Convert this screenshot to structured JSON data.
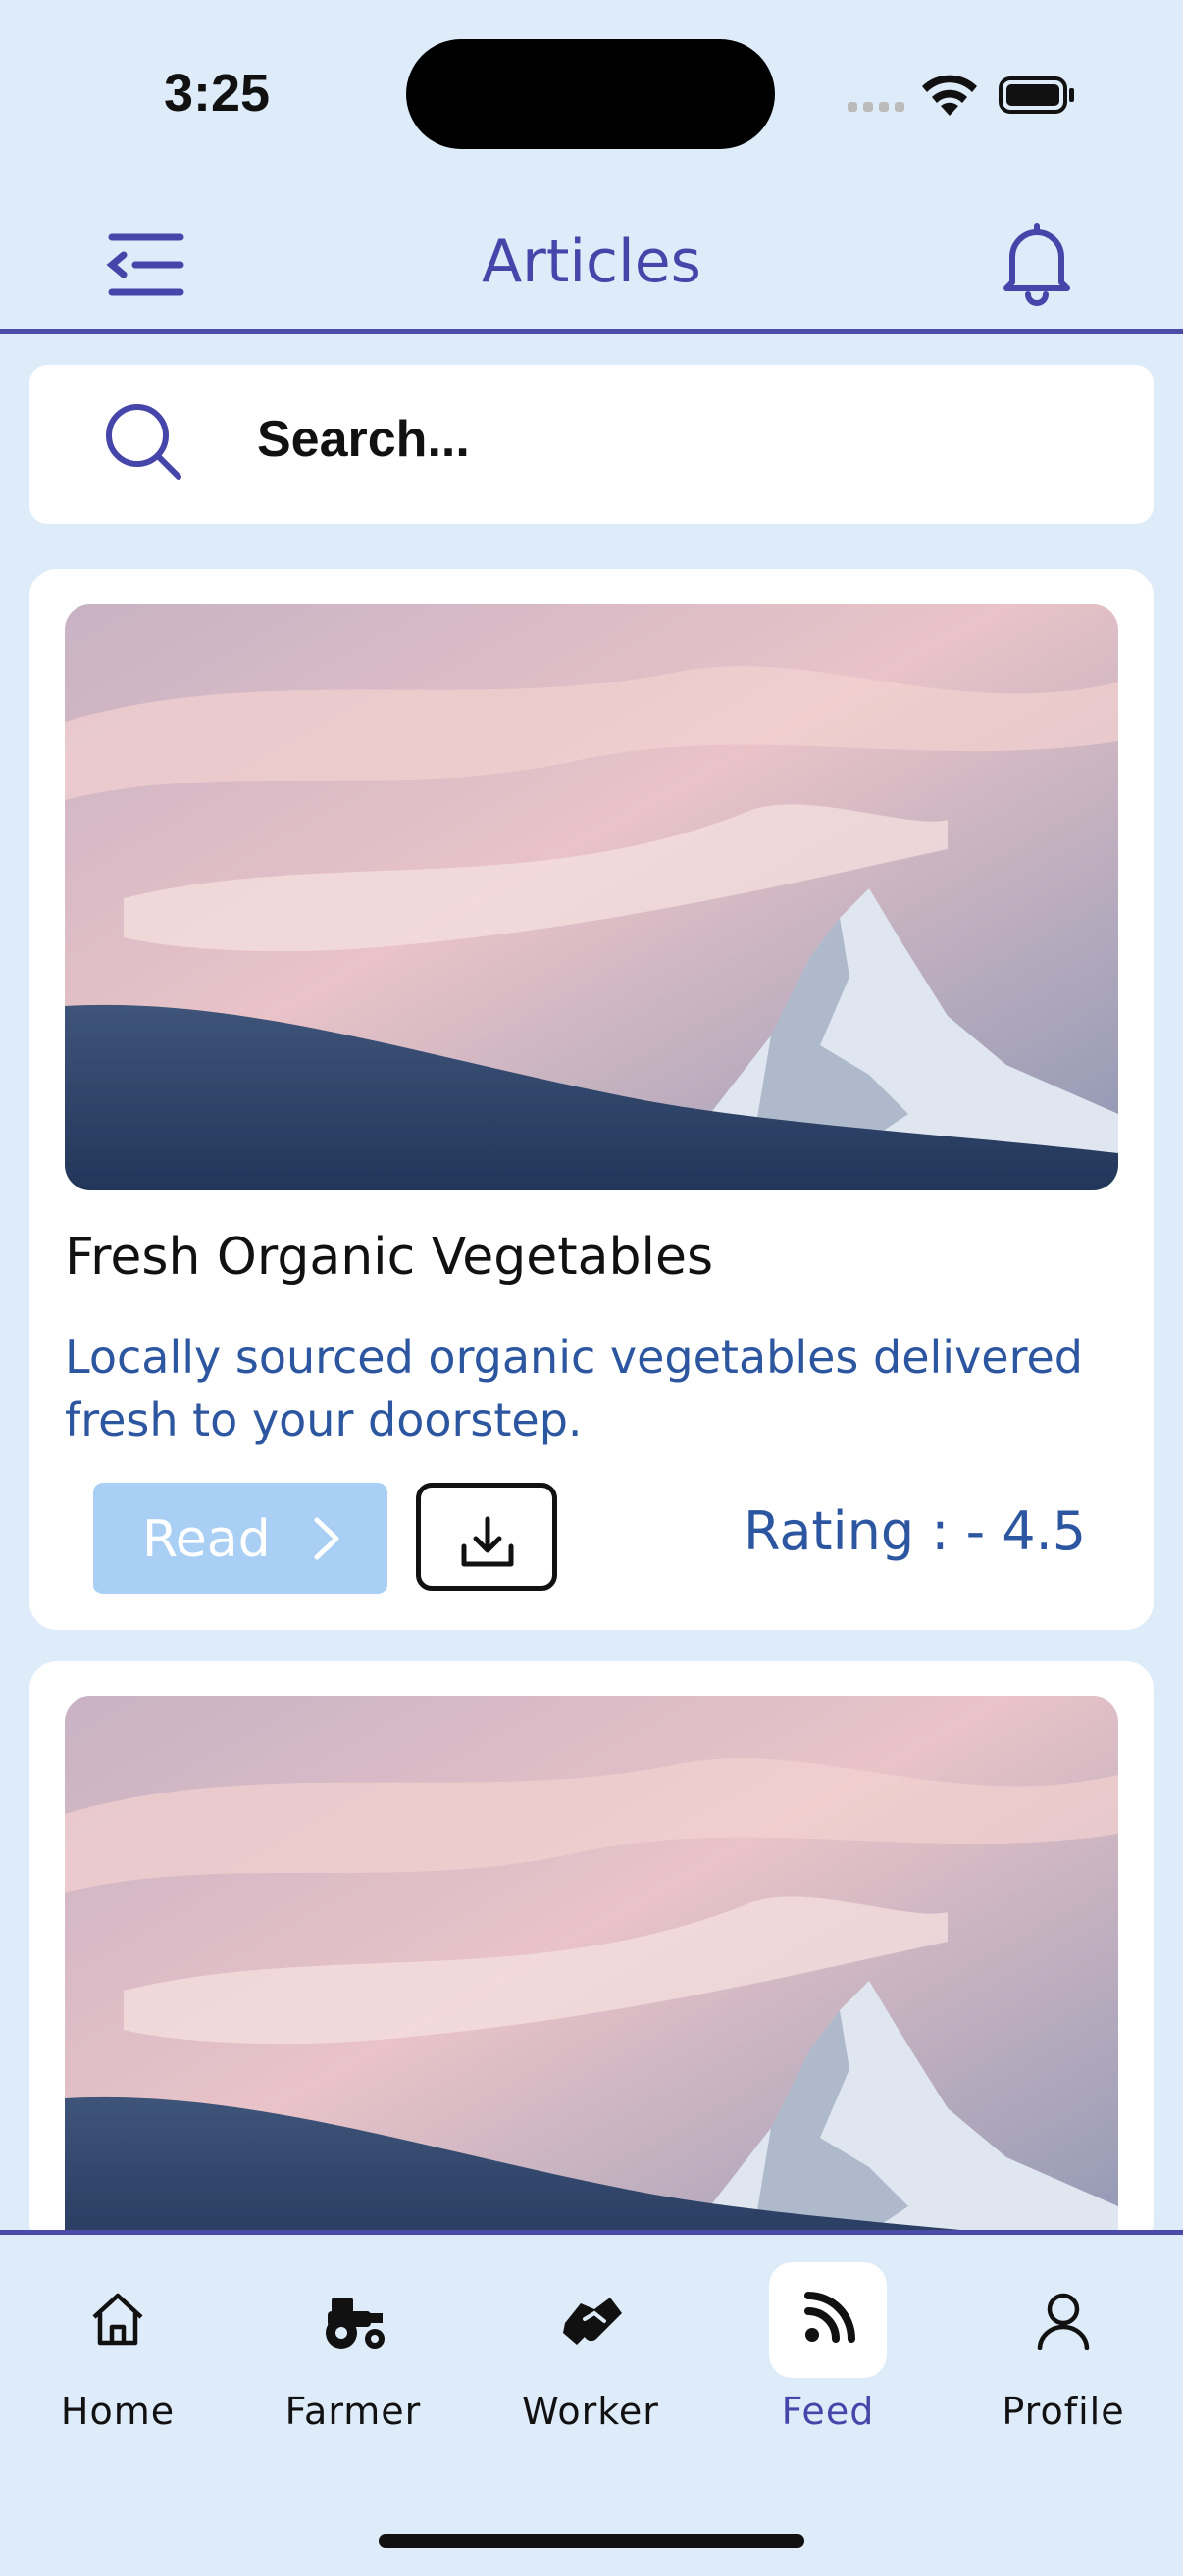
{
  "status_bar": {
    "time": "3:25"
  },
  "header": {
    "title": "Articles",
    "menu_icon": "menu-collapse-icon",
    "bell_icon": "bell-icon"
  },
  "search": {
    "placeholder": "Search...",
    "icon": "search-icon"
  },
  "articles": [
    {
      "title": "Fresh Organic Vegetables",
      "description": "Locally sourced organic vegetables delivered fresh to your doorstep.",
      "read_label": "Read",
      "rating_label": "Rating : - 4.5"
    }
  ],
  "bottom_nav": {
    "items": [
      {
        "label": "Home",
        "icon": "home-icon"
      },
      {
        "label": "Farmer",
        "icon": "tractor-icon"
      },
      {
        "label": "Worker",
        "icon": "handshake-icon"
      },
      {
        "label": "Feed",
        "icon": "rss-feed-icon",
        "active": true
      },
      {
        "label": "Profile",
        "icon": "person-icon"
      }
    ]
  },
  "colors": {
    "accent": "#4646aa",
    "background": "#deebf9",
    "link": "#2d56a0",
    "read_button": "#a9d0f4"
  }
}
